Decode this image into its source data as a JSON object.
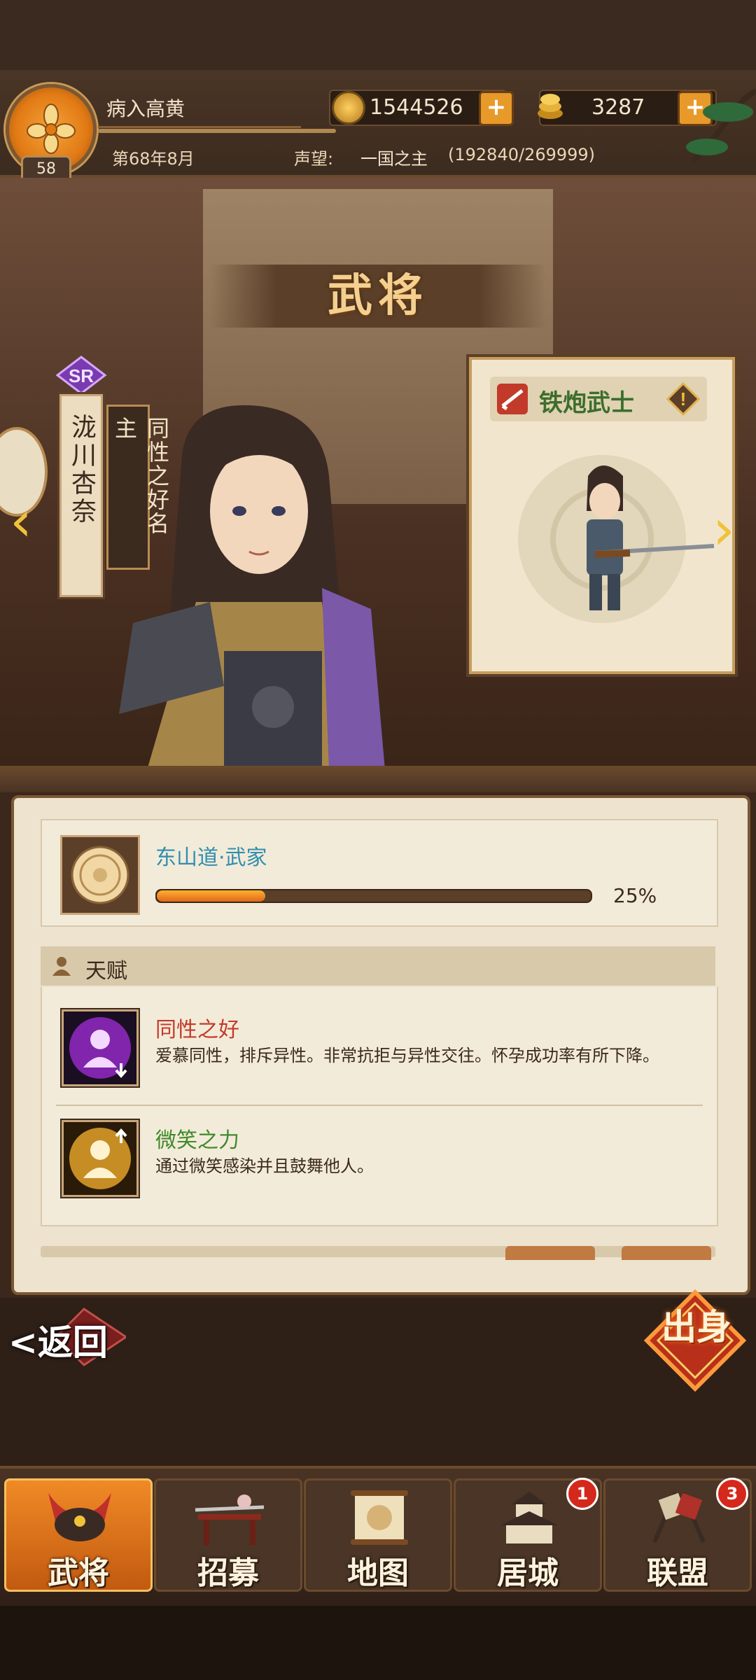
{
  "header": {
    "player_name": "病入高黄",
    "level": "58",
    "date": "第68年8月",
    "fame_label": "声望:",
    "fame_rank": "一国之主",
    "fame_progress": "(192840/269999)",
    "coins": "1544526",
    "gold": "3287",
    "plus_symbol": "+"
  },
  "page": {
    "title": "武将"
  },
  "hero": {
    "rarity": "SR",
    "name": "泷川杏奈",
    "title": "同性之好名主",
    "prev_arrow": "‹",
    "next_arrow": "›"
  },
  "unit": {
    "name": "铁炮武士",
    "warn_symbol": "!"
  },
  "clan": {
    "name": "东山道·武家",
    "progress_percent": 25,
    "progress_label": "25%"
  },
  "talents": {
    "header": "天赋",
    "items": [
      {
        "name": "同性之好",
        "name_color": "#c43a2a",
        "desc": "爱慕同性，排斥异性。非常抗拒与异性交往。怀孕成功率有所下降。",
        "icon_color": "#9a2ad0"
      },
      {
        "name": "微笑之力",
        "name_color": "#3f8a2a",
        "desc": "通过微笑感染并且鼓舞他人。",
        "icon_color": "#e2a22a"
      }
    ]
  },
  "actions": {
    "back": "<返回",
    "deploy": "出身"
  },
  "nav": {
    "tabs": [
      {
        "label": "武将",
        "active": true,
        "badge": ""
      },
      {
        "label": "招募",
        "active": false,
        "badge": ""
      },
      {
        "label": "地图",
        "active": false,
        "badge": ""
      },
      {
        "label": "居城",
        "active": false,
        "badge": "1"
      },
      {
        "label": "联盟",
        "active": false,
        "badge": "3"
      }
    ]
  }
}
